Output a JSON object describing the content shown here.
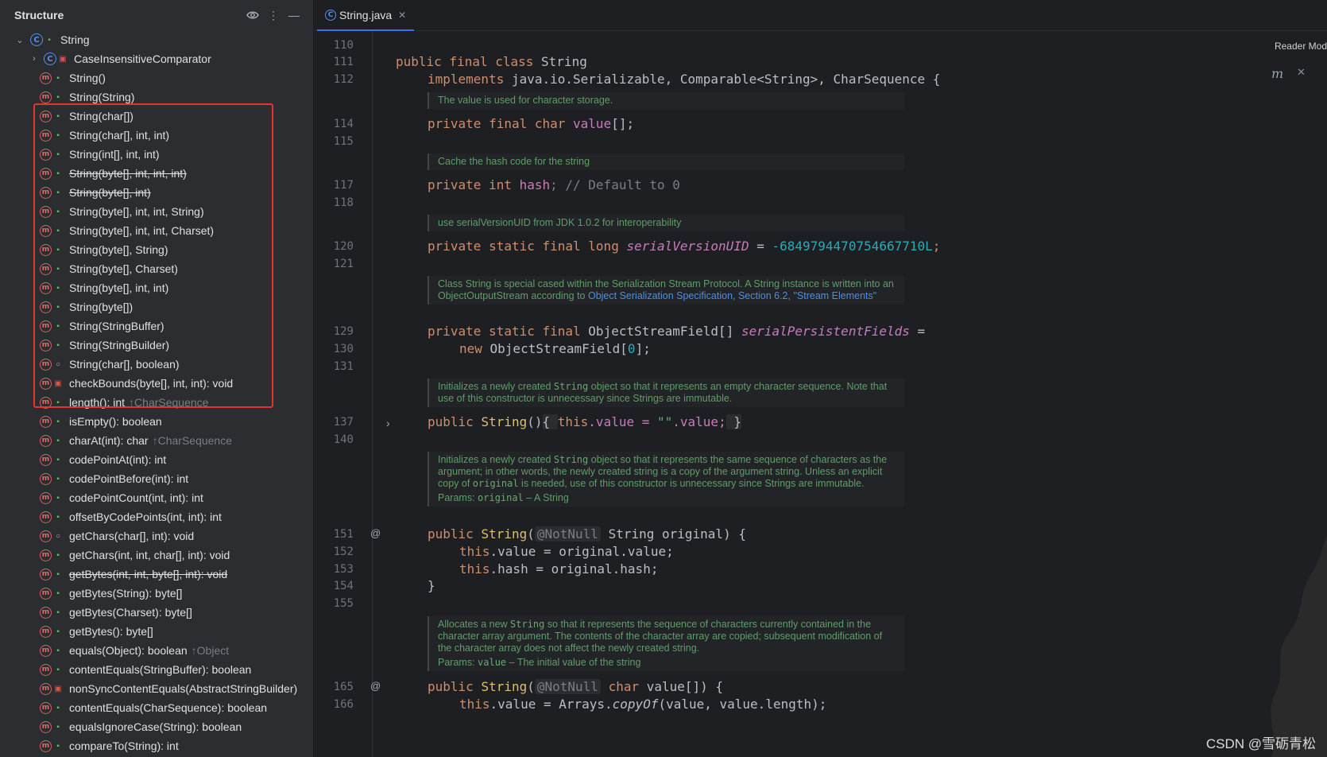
{
  "structure": {
    "title": "Structure",
    "root": {
      "label": "String"
    },
    "items": [
      {
        "label": "CaseInsensitiveComparator",
        "kind": "class",
        "visibility": "private",
        "expandable": true
      },
      {
        "label": "String()",
        "kind": "method",
        "visibility": "public"
      },
      {
        "label": "String(String)",
        "kind": "method",
        "visibility": "public"
      },
      {
        "label": "String(char[])",
        "kind": "method",
        "visibility": "public"
      },
      {
        "label": "String(char[], int, int)",
        "kind": "method",
        "visibility": "public"
      },
      {
        "label": "String(int[], int, int)",
        "kind": "method",
        "visibility": "public"
      },
      {
        "label": "String(byte[], int, int, int)",
        "kind": "method",
        "visibility": "public",
        "deprecated": true
      },
      {
        "label": "String(byte[], int)",
        "kind": "method",
        "visibility": "public",
        "deprecated": true
      },
      {
        "label": "String(byte[], int, int, String)",
        "kind": "method",
        "visibility": "public"
      },
      {
        "label": "String(byte[], int, int, Charset)",
        "kind": "method",
        "visibility": "public"
      },
      {
        "label": "String(byte[], String)",
        "kind": "method",
        "visibility": "public"
      },
      {
        "label": "String(byte[], Charset)",
        "kind": "method",
        "visibility": "public"
      },
      {
        "label": "String(byte[], int, int)",
        "kind": "method",
        "visibility": "public"
      },
      {
        "label": "String(byte[])",
        "kind": "method",
        "visibility": "public"
      },
      {
        "label": "String(StringBuffer)",
        "kind": "method",
        "visibility": "public"
      },
      {
        "label": "String(StringBuilder)",
        "kind": "method",
        "visibility": "public"
      },
      {
        "label": "String(char[], boolean)",
        "kind": "method",
        "visibility": "package"
      },
      {
        "label": "checkBounds(byte[], int, int): void",
        "kind": "method",
        "visibility": "private"
      },
      {
        "label": "length(): int",
        "kind": "method",
        "visibility": "public",
        "inherited": "↑CharSequence"
      },
      {
        "label": "isEmpty(): boolean",
        "kind": "method",
        "visibility": "public"
      },
      {
        "label": "charAt(int): char",
        "kind": "method",
        "visibility": "public",
        "inherited": "↑CharSequence"
      },
      {
        "label": "codePointAt(int): int",
        "kind": "method",
        "visibility": "public"
      },
      {
        "label": "codePointBefore(int): int",
        "kind": "method",
        "visibility": "public"
      },
      {
        "label": "codePointCount(int, int): int",
        "kind": "method",
        "visibility": "public"
      },
      {
        "label": "offsetByCodePoints(int, int): int",
        "kind": "method",
        "visibility": "public"
      },
      {
        "label": "getChars(char[], int): void",
        "kind": "method",
        "visibility": "package"
      },
      {
        "label": "getChars(int, int, char[], int): void",
        "kind": "method",
        "visibility": "public"
      },
      {
        "label": "getBytes(int, int, byte[], int): void",
        "kind": "method",
        "visibility": "public",
        "deprecated": true
      },
      {
        "label": "getBytes(String): byte[]",
        "kind": "method",
        "visibility": "public"
      },
      {
        "label": "getBytes(Charset): byte[]",
        "kind": "method",
        "visibility": "public"
      },
      {
        "label": "getBytes(): byte[]",
        "kind": "method",
        "visibility": "public"
      },
      {
        "label": "equals(Object): boolean",
        "kind": "method",
        "visibility": "public",
        "inherited": "↑Object"
      },
      {
        "label": "contentEquals(StringBuffer): boolean",
        "kind": "method",
        "visibility": "public"
      },
      {
        "label": "nonSyncContentEquals(AbstractStringBuilder)",
        "kind": "method",
        "visibility": "private"
      },
      {
        "label": "contentEquals(CharSequence): boolean",
        "kind": "method",
        "visibility": "public"
      },
      {
        "label": "equalsIgnoreCase(String): boolean",
        "kind": "method",
        "visibility": "public"
      },
      {
        "label": "compareTo(String): int",
        "kind": "method",
        "visibility": "public"
      }
    ]
  },
  "tab": {
    "label": "String.java"
  },
  "reader_mode": "Reader Mod",
  "line_numbers": [
    "110",
    "111",
    "112",
    "114",
    "115",
    "117",
    "118",
    "120",
    "121",
    "129",
    "130",
    "131",
    "137",
    "140",
    "151",
    "152",
    "153",
    "154",
    "155",
    "165",
    "166"
  ],
  "code": {
    "l111": {
      "kw": "public final class ",
      "name": "String"
    },
    "l112": {
      "kw": "implements ",
      "rest": "java.io.Serializable, Comparable<String>, CharSequence {"
    },
    "l114": {
      "kw": "private final char ",
      "field": "value",
      "rest": "[];"
    },
    "l117": {
      "kw": "private int ",
      "field": "hash",
      "rest": "; // Default to 0"
    },
    "l120": {
      "kw": "private static final long ",
      "field": "serialVersionUID",
      "eq": " = ",
      "num": "-6849794470754667710L",
      "end": ";"
    },
    "l129": {
      "kw": "private static final ",
      "type": "ObjectStreamField[] ",
      "field": "serialPersistentFields",
      "end": " ="
    },
    "l130": {
      "kw": "new ",
      "type": "ObjectStreamField[",
      "num": "0",
      "end": "];"
    },
    "l137": {
      "kw": "public ",
      "name": "String",
      "paren": "()",
      "b1": "{ ",
      "this": "this",
      "mid": ".value = ",
      "str": "\"\"",
      "mid2": ".value;",
      "b2": " }"
    },
    "l151": {
      "kw": "public ",
      "name": "String",
      "paren": "(",
      "ann": "@NotNull",
      "rest": " String original) {"
    },
    "l152": {
      "this": "this",
      "rest": ".value = original.value;"
    },
    "l153": {
      "this": "this",
      "rest": ".hash = original.hash;"
    },
    "l154": {
      "rest": "}"
    },
    "l165": {
      "kw": "public ",
      "name": "String",
      "paren": "(",
      "ann": "@NotNull",
      "kw2": " char ",
      "rest": "value[]) {"
    },
    "l166": {
      "this": "this",
      "rest": ".value = Arrays.",
      "fn": "copyOf",
      "rest2": "(value, value.length);"
    }
  },
  "docs": {
    "d1": "The value is used for character storage.",
    "d2": "Cache the hash code for the string",
    "d3": "use serialVersionUID from JDK 1.0.2 for interoperability",
    "d4a": "Class String is special cased within the Serialization Stream Protocol. A String instance is written into an ObjectOutputStream according to ",
    "d4link": "Object Serialization Specification, Section 6.2, \"Stream Elements\"",
    "d5a": "Initializes a newly created ",
    "d5code": "String",
    "d5b": " object so that it represents an empty character sequence. Note that use of this constructor is unnecessary since Strings are immutable.",
    "d6a": "Initializes a newly created ",
    "d6code": "String",
    "d6b": " object so that it represents the same sequence of characters as the argument; in other words, the newly created string is a copy of the argument string. Unless an explicit copy of ",
    "d6code2": "original",
    "d6c": " is needed, use of this constructor is unnecessary since Strings are immutable.",
    "d6params_label": "Params: ",
    "d6params_code": "original",
    "d6params_desc": " – A String",
    "d7a": "Allocates a new ",
    "d7code": "String",
    "d7b": " so that it represents the sequence of characters currently contained in the character array argument. The contents of the character array are copied; subsequent modification of the character array does not affect the newly created string.",
    "d7params_label": "Params: ",
    "d7params_code": "value",
    "d7params_desc": " – The initial value of the string"
  },
  "gutter_icons": {
    "at": "@",
    "fold": "›"
  },
  "watermark": "CSDN @雪砺青松",
  "colors": {
    "accent": "#3574f0",
    "highlight_box": "#e3342f",
    "keyword": "#cf8e6d",
    "field": "#c77dbb",
    "number": "#2aacb8",
    "doc": "#5f9e68"
  }
}
